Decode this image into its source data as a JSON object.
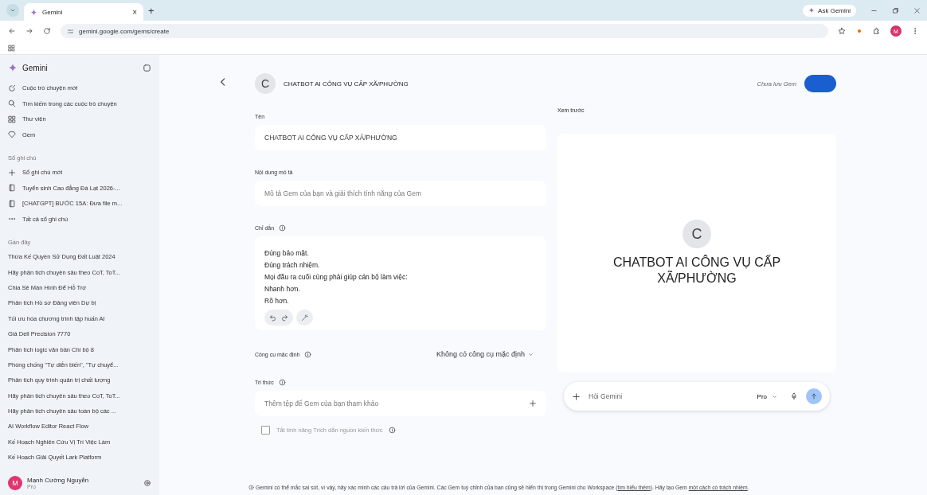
{
  "browser": {
    "tab_title": "Gemini",
    "tab_close": "×",
    "new_tab": "+",
    "url": "gemini.google.com/gems/create",
    "ask_gemini": "Ask Gemini",
    "profile_initial": "M"
  },
  "sidebar": {
    "title": "Gemini",
    "nav": [
      {
        "label": "Cuộc trò chuyện mới",
        "kind": "new-chat"
      },
      {
        "label": "Tìm kiếm trong các cuộc trò chuyện",
        "kind": "search"
      },
      {
        "label": "Thư viện",
        "kind": "library"
      },
      {
        "label": "Gem",
        "kind": "gem"
      }
    ],
    "notebooks_heading": "Sổ ghi chú",
    "notebooks": [
      {
        "label": "Sổ ghi chú mới",
        "kind": "add"
      },
      {
        "label": "Tuyển sinh Cao đẳng Đà Lạt 2026-...",
        "kind": "notebook"
      },
      {
        "label": "[CHATGPT] BƯỚC 15A: Đưa file m...",
        "kind": "notebook"
      },
      {
        "label": "Tất cả sổ ghi chú",
        "kind": "more"
      }
    ],
    "recent_heading": "Gần đây",
    "recent": [
      "Thừa Kế Quyền Sử Dụng Đất Luật 2024",
      "Hãy phân tích chuyên sâu theo CoT, ToT...",
      "Chia Sẻ Màn Hình Để Hỗ Trợ",
      "Phân tích Hồ sơ Đảng viên Dự bị",
      "Tối ưu hóa chương trình tập huấn AI",
      "Giá Dell Precision 7770",
      "Phân tích logic văn bản Chi bộ 8",
      "Phòng chống \"Tự diễn biến\", \"Tự chuyể...",
      "Phân tích quy trình quản trị chất lượng",
      "Hãy phân tích chuyên sâu theo CoT, ToT...",
      "Hãy phân tích chuyên sâu toàn bộ các ...",
      "AI Workflow Editor React Flow",
      "Kế Hoạch Nghiên Cứu Vị Trí Việc Làm",
      "Kế Hoạch Giải Quyết Lark Platform"
    ],
    "user": {
      "initial": "M",
      "name": "Mạnh Cường Nguyễn",
      "plan": "Pro"
    }
  },
  "header": {
    "avatar": "C",
    "title": "CHATBOT AI CÔNG VỤ CẤP XÃ/PHƯỜNG",
    "status": "Chưa lưu Gem"
  },
  "form": {
    "name_label": "Tên",
    "name_value": "CHATBOT AI CÔNG VỤ CẤP XÃ/PHƯỜNG",
    "description_label": "Nội dung mô tả",
    "description_placeholder": "Mô tả Gem của bạn và giải thích tính năng của Gem",
    "instructions_label": "Chỉ dẫn",
    "instructions_lines": [
      "Đúng bảo mật.",
      "Đúng trách nhiệm.",
      "Mọi đầu ra cuối cùng phải giúp cán bộ làm việc:",
      "Nhanh hơn.",
      "Rõ hơn."
    ],
    "tools_label": "Công cụ mặc định",
    "tools_value": "Không có công cụ mặc định",
    "knowledge_label": "Tri thức",
    "knowledge_placeholder": "Thêm tệp để Gem của bạn tham khảo",
    "citation": {
      "label": "Tắt tính năng Trích dẫn nguồn kiến thức",
      "checked": false,
      "disabled": true
    }
  },
  "preview": {
    "label": "Xem trước",
    "avatar": "C",
    "title": "CHATBOT AI CÔNG VỤ CẤP XÃ/PHƯỜNG",
    "input_placeholder": "Hỏi Gemini",
    "model": "Pro"
  },
  "footer": {
    "text_before": "Gemini có thể mắc sai sót, vì vậy, hãy xác minh các câu trả lời của Gemini. Các Gem tuỳ chỉnh của bạn cũng sẽ hiển thị trong Gemini cho Workspace (",
    "link_1": "tìm hiểu thêm",
    "text_middle": "). Hãy tạo Gem ",
    "link_2": "một cách có trách nhiệm",
    "text_after": "."
  }
}
